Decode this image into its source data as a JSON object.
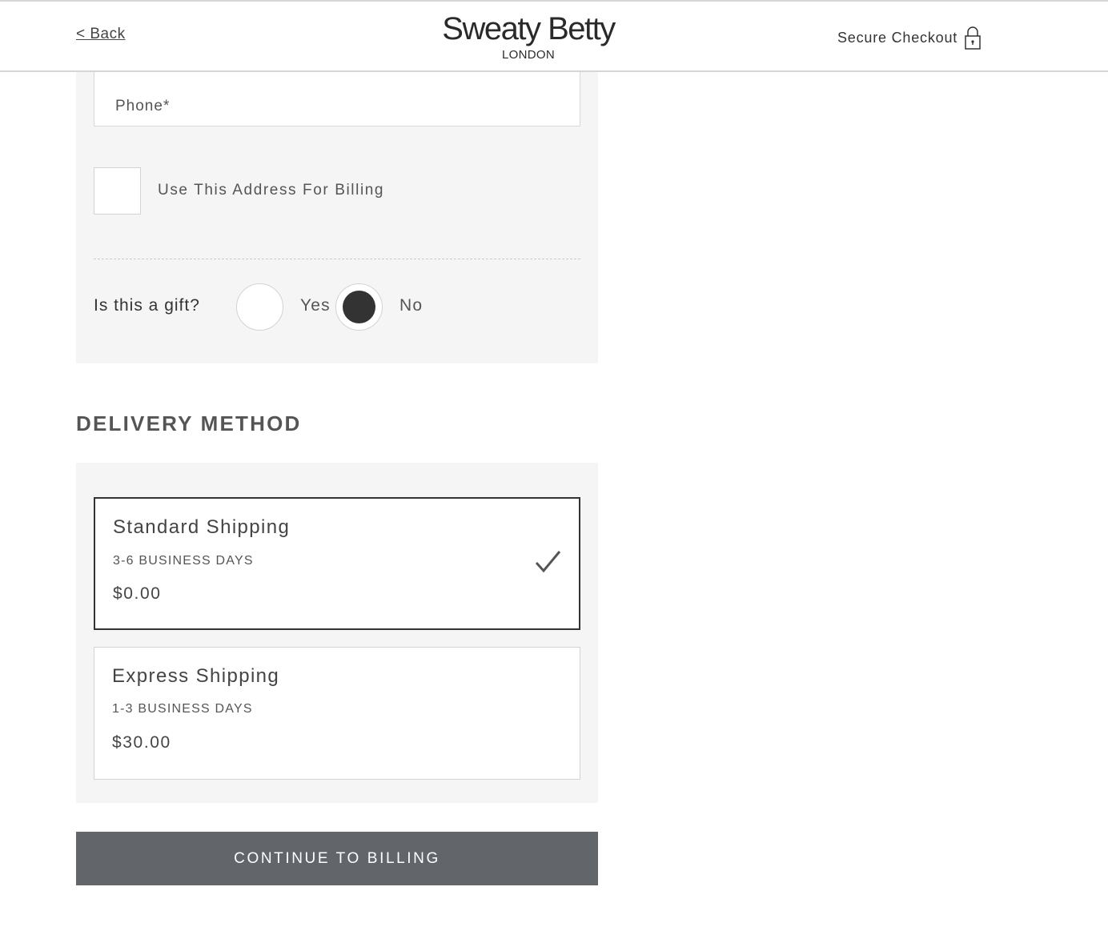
{
  "header": {
    "back_label": "< Back",
    "logo_main": "Sweaty Betty",
    "logo_sub": "LONDON",
    "secure_label": "Secure Checkout",
    "secure_icon": "lock-icon"
  },
  "shipping_form": {
    "phone_placeholder": "Phone*",
    "phone_value": "",
    "billing_checkbox_label": "Use This Address For Billing",
    "billing_checked": false,
    "gift_question": "Is this a gift?",
    "gift_options": [
      {
        "label": "Yes",
        "selected": false
      },
      {
        "label": "No",
        "selected": true
      }
    ]
  },
  "delivery": {
    "title": "DELIVERY METHOD",
    "options": [
      {
        "name": "Standard Shipping",
        "days": "3-6 BUSINESS DAYS",
        "price": "$0.00",
        "selected": true,
        "icon": "checkmark-icon"
      },
      {
        "name": "Express Shipping",
        "days": "1-3 BUSINESS DAYS",
        "price": "$30.00",
        "selected": false
      }
    ]
  },
  "actions": {
    "continue_label": "CONTINUE TO BILLING"
  },
  "colors": {
    "panel_bg": "#f5f5f5",
    "button_bg": "#626569",
    "selected_border": "#333333",
    "text": "#444444"
  }
}
